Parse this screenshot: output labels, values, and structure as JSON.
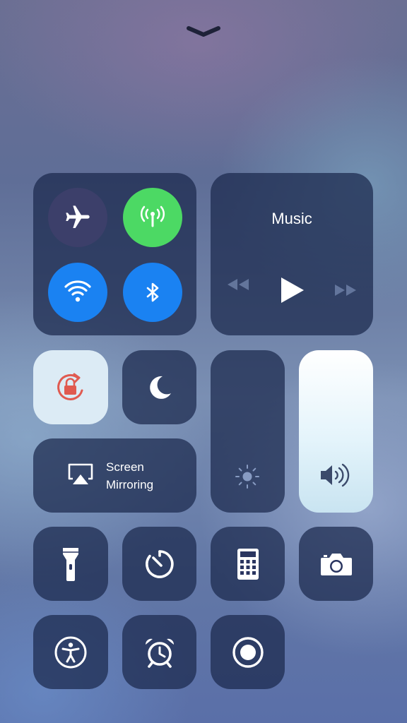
{
  "colors": {
    "tile": "#1a284c",
    "green": "#4cd964",
    "blue": "#1a82f2",
    "airplane_off": "#3c3f6a",
    "light_tile": "#dcebf5",
    "lock_red": "#e05a50"
  },
  "music": {
    "title": "Music"
  },
  "screen_mirroring": {
    "line1": "Screen",
    "line2": "Mirroring"
  },
  "connectivity": {
    "airplane_mode": "off",
    "cellular_data": "on",
    "wifi": "on",
    "bluetooth": "on"
  },
  "toggles": {
    "rotation_lock": "on",
    "do_not_disturb": "off"
  },
  "sliders": {
    "brightness_level": 0.0,
    "volume_level": 1.0
  },
  "icons": [
    "chevron-down-icon",
    "airplane-icon",
    "cellular-icon",
    "wifi-icon",
    "bluetooth-icon",
    "rewind-icon",
    "play-icon",
    "fast-forward-icon",
    "rotation-lock-icon",
    "moon-icon",
    "airplay-icon",
    "brightness-icon",
    "volume-icon",
    "flashlight-icon",
    "timer-icon",
    "calculator-icon",
    "camera-icon",
    "accessibility-icon",
    "alarm-icon",
    "screen-record-icon"
  ]
}
